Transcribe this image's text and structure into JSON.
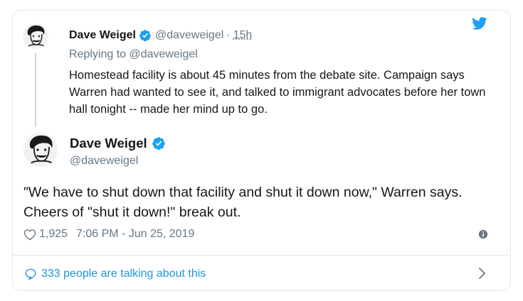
{
  "parent_tweet": {
    "name": "Dave Weigel",
    "handle": "@daveweigel",
    "separator": "·",
    "time": "15h",
    "replying_to": "Replying to @daveweigel",
    "text": "Homestead facility is about 45 minutes from the debate site. Campaign says Warren had wanted to see it, and talked to immigrant advocates before her town hall tonight -- made her mind up to go."
  },
  "main_tweet": {
    "name": "Dave Weigel",
    "handle": "@daveweigel",
    "text": "\"We have to shut down that facility and shut it down now,\" Warren says. Cheers of \"shut it down!\" break out.",
    "likes": "1,925",
    "timestamp": "7:06 PM - Jun 25, 2019"
  },
  "footer": {
    "talking": "333 people are talking about this"
  },
  "icons": {
    "brand": "twitter-bird-icon",
    "verified": "verified-badge-icon",
    "like": "heart-icon",
    "info": "info-icon",
    "reply": "speech-bubble-icon",
    "chevron": "chevron-right-icon"
  },
  "colors": {
    "twitter_blue": "#1da1f2",
    "link_blue": "#1b95e0",
    "secondary_text": "#657786",
    "border": "#e1e8ed"
  }
}
